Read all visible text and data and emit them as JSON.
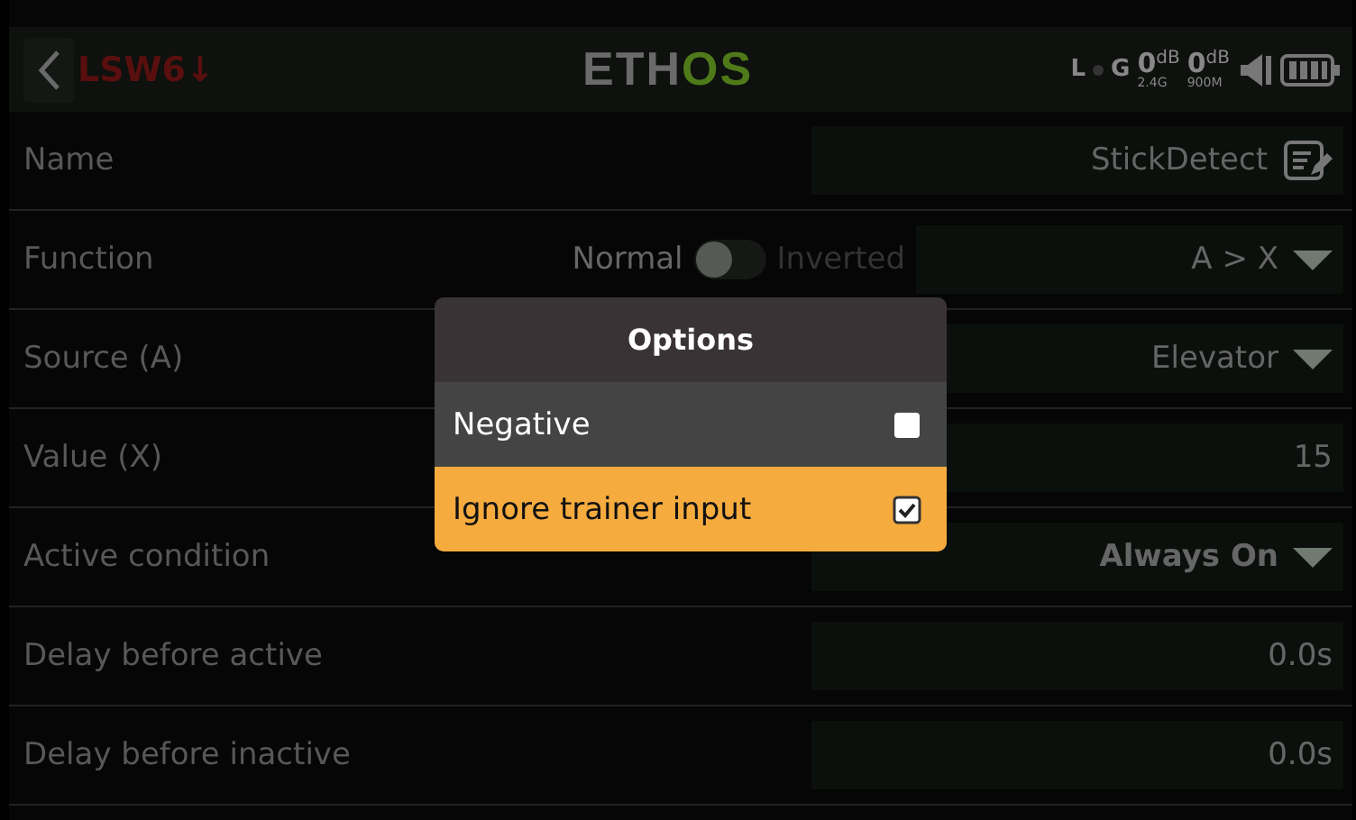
{
  "header": {
    "title": "LSW6↓",
    "logo": [
      "ETH",
      "OS"
    ],
    "status": {
      "rx_label": "L",
      "gps_label": "G",
      "readings": [
        {
          "value": "0",
          "unit": "dB",
          "band": "2.4G"
        },
        {
          "value": "0",
          "unit": "dB",
          "band": "900M"
        }
      ]
    }
  },
  "rows": [
    {
      "kind": "text",
      "label": "Name",
      "value": "StickDetect"
    },
    {
      "kind": "function",
      "label": "Function",
      "toggle": {
        "off_label": "Normal",
        "on_label": "Inverted",
        "on": false
      },
      "value": "A > X"
    },
    {
      "kind": "choice",
      "label": "Source (A)",
      "value": "Elevator"
    },
    {
      "kind": "number",
      "label": "Value (X)",
      "value": "15"
    },
    {
      "kind": "choice",
      "label": "Active condition",
      "value": "Always On",
      "emphasized": true
    },
    {
      "kind": "number",
      "label": "Delay before active",
      "value": "0.0s"
    },
    {
      "kind": "number",
      "label": "Delay before inactive",
      "value": "0.0s"
    }
  ],
  "dialog": {
    "title": "Options",
    "items": [
      {
        "label": "Negative",
        "checked": false,
        "selected": false
      },
      {
        "label": "Ignore trainer input",
        "checked": true,
        "selected": true
      }
    ]
  }
}
